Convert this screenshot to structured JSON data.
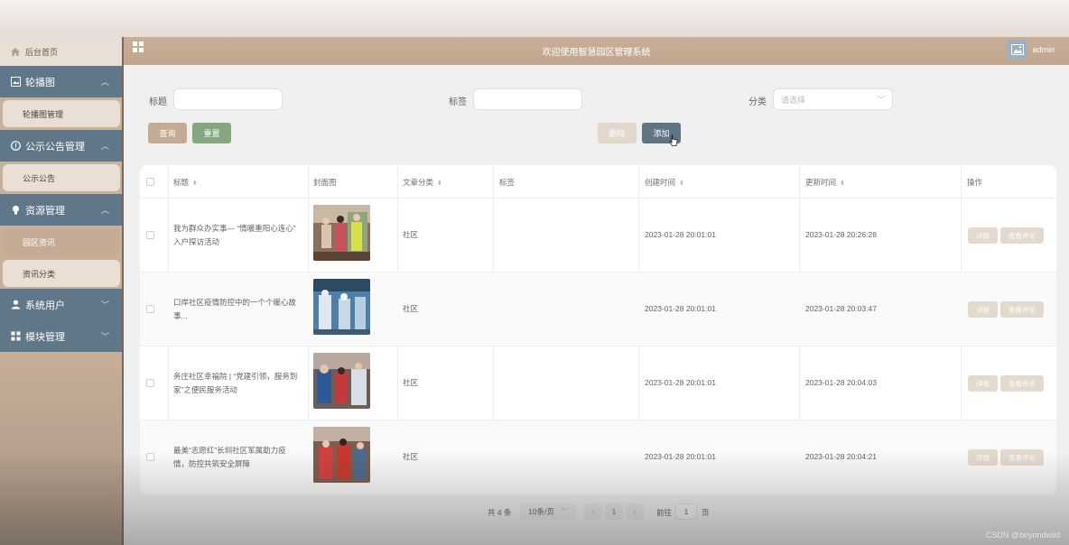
{
  "header": {
    "title": "欢迎使用智慧园区管理系统",
    "username": "admin"
  },
  "sidebar": {
    "home": "后台首页",
    "groups": [
      {
        "label": "轮播图",
        "items": [
          "轮播图管理"
        ]
      },
      {
        "label": "公示公告管理",
        "items": [
          "公示公告"
        ]
      },
      {
        "label": "资源管理",
        "items": [
          "园区资讯",
          "资讯分类"
        ]
      },
      {
        "label": "系统用户",
        "items": []
      },
      {
        "label": "模块管理",
        "items": []
      }
    ]
  },
  "search": {
    "title_label": "标题",
    "tag_label": "标签",
    "category_label": "分类",
    "category_placeholder": "请选择",
    "query_button": "查询",
    "reset_button": "重置",
    "delete_button": "删除",
    "add_button": "添加"
  },
  "table": {
    "columns": [
      "标题",
      "封面图",
      "文章分类",
      "标签",
      "创建时间",
      "更新时间",
      "操作"
    ],
    "rows": [
      {
        "title_line1": "我为群众办实事— “情暖重阳心连心”",
        "title_line2": "入户探访活动",
        "category": "社区",
        "tag": "",
        "created": "2023-01-28 20:01:01",
        "updated": "2023-01-28 20:26:28"
      },
      {
        "title_line1": "口岸社区疫情防控中的一个个暖心故",
        "title_line2": "事...",
        "category": "社区",
        "tag": "",
        "created": "2023-01-28 20:01:01",
        "updated": "2023-01-28 20:03:47"
      },
      {
        "title_line1": "务庄社区幸福院 | “党建引领，服务到",
        "title_line2": "家”之便民服务活动",
        "category": "社区",
        "tag": "",
        "created": "2023-01-28 20:01:01",
        "updated": "2023-01-28 20:04:03"
      },
      {
        "title_line1": "最美“志愿红”长圳社区军属助力疫",
        "title_line2": "情，防控共筑安全屏障",
        "category": "社区",
        "tag": "",
        "created": "2023-01-28 20:01:01",
        "updated": "2023-01-28 20:04:21"
      }
    ],
    "detail_button": "详情",
    "comment_button": "查看评论"
  },
  "pagination": {
    "total": "共 4 条",
    "page_size": "10条/页",
    "current_page": "1",
    "goto_label": "前往",
    "goto_value": "1",
    "page_unit": "页"
  },
  "watermark": "CSDN @beyondwild",
  "colors": {
    "sidebar_group": "#5f7789",
    "header": "#c8ae97",
    "reset_button": "#86a67f",
    "add_button": "#5f7584",
    "query_button": "#c4ab93"
  }
}
